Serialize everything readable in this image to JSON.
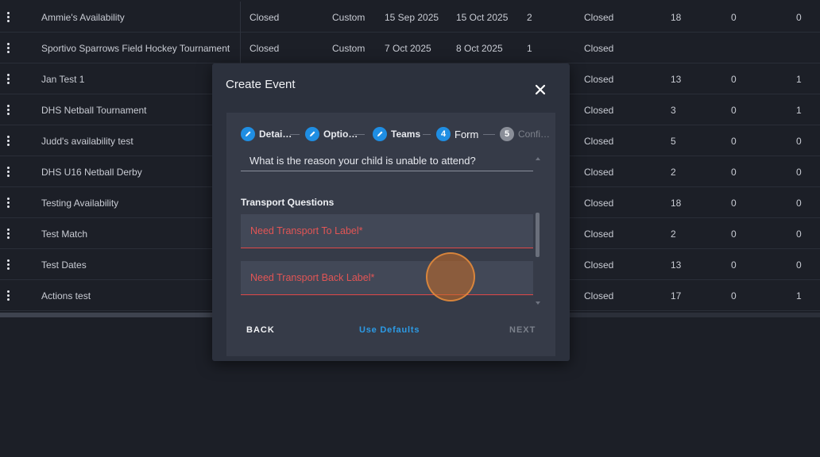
{
  "table": {
    "rows": [
      {
        "name": "Ammie's Availability",
        "status": "Closed",
        "type": "Custom",
        "start": "15 Sep 2025",
        "end": "15 Oct 2025",
        "num": "2",
        "state": "Closed",
        "a": "18",
        "b": "0",
        "c": "0"
      },
      {
        "name": "Sportivo Sparrows Field Hockey Tournament",
        "status": "Closed",
        "type": "Custom",
        "start": "7 Oct 2025",
        "end": "8 Oct 2025",
        "num": "1",
        "state": "Closed",
        "a": "",
        "b": "",
        "c": ""
      },
      {
        "name": "Jan Test 1",
        "status": "",
        "type": "",
        "start": "",
        "end": "",
        "num": "",
        "state": "Closed",
        "a": "13",
        "b": "0",
        "c": "1"
      },
      {
        "name": "DHS Netball Tournament",
        "status": "",
        "type": "",
        "start": "",
        "end": "",
        "num": "",
        "state": "Closed",
        "a": "3",
        "b": "0",
        "c": "1"
      },
      {
        "name": "Judd's availability test",
        "status": "",
        "type": "",
        "start": "",
        "end": "",
        "num": "",
        "state": "Closed",
        "a": "5",
        "b": "0",
        "c": "0"
      },
      {
        "name": "DHS U16 Netball Derby",
        "status": "",
        "type": "",
        "start": "",
        "end": "",
        "num": "",
        "state": "Closed",
        "a": "2",
        "b": "0",
        "c": "0"
      },
      {
        "name": "Testing Availability",
        "status": "",
        "type": "",
        "start": "",
        "end": "",
        "num": "",
        "state": "Closed",
        "a": "18",
        "b": "0",
        "c": "0"
      },
      {
        "name": "Test Match",
        "status": "",
        "type": "",
        "start": "",
        "end": "",
        "num": "",
        "state": "Closed",
        "a": "2",
        "b": "0",
        "c": "0"
      },
      {
        "name": "Test Dates",
        "status": "",
        "type": "",
        "start": "",
        "end": "",
        "num": "",
        "state": "Closed",
        "a": "13",
        "b": "0",
        "c": "0"
      },
      {
        "name": "Actions test",
        "status": "",
        "type": "",
        "start": "",
        "end": "",
        "num": "",
        "state": "Closed",
        "a": "17",
        "b": "0",
        "c": "1"
      }
    ]
  },
  "dialog": {
    "title": "Create Event",
    "steps": [
      {
        "number": "",
        "label": "Detai…",
        "state": "done"
      },
      {
        "number": "",
        "label": "Optio…",
        "state": "done"
      },
      {
        "number": "",
        "label": "Teams",
        "state": "done"
      },
      {
        "number": "4",
        "label": "Form",
        "state": "active"
      },
      {
        "number": "5",
        "label": "Confi…",
        "state": "pending"
      }
    ],
    "reason_value": "What is the reason your child is unable to attend?",
    "section_title": "Transport Questions",
    "transport_to_placeholder": "Need Transport To Label*",
    "transport_back_placeholder": "Need Transport Back Label*",
    "back_label": "BACK",
    "defaults_label": "Use Defaults",
    "next_label": "NEXT"
  },
  "colors": {
    "accent": "#1f8ee3",
    "error": "#e04848",
    "link": "#2c9be6"
  }
}
